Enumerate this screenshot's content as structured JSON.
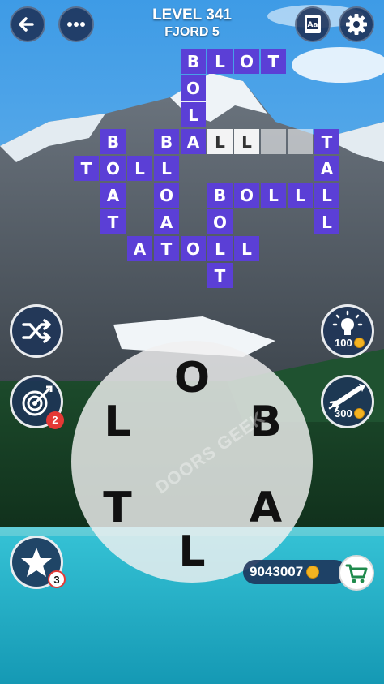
{
  "header": {
    "level_title": "LEVEL 341",
    "pack_name": "FJORD 5"
  },
  "grid": {
    "solved_color": "#5b3fd6",
    "cells": [
      {
        "id": "r0c4",
        "letter": "B",
        "state": "solved"
      },
      {
        "id": "r0c5",
        "letter": "L",
        "state": "solved"
      },
      {
        "id": "r0c6",
        "letter": "O",
        "state": "solved"
      },
      {
        "id": "r0c7",
        "letter": "T",
        "state": "solved"
      },
      {
        "id": "r1c4",
        "letter": "O",
        "state": "solved"
      },
      {
        "id": "r2c4",
        "letter": "L",
        "state": "solved"
      },
      {
        "id": "r3c1",
        "letter": "B",
        "state": "solved"
      },
      {
        "id": "r3c3",
        "letter": "B",
        "state": "solved"
      },
      {
        "id": "r3c4",
        "letter": "A",
        "state": "solved"
      },
      {
        "id": "r3c5",
        "letter": "L",
        "state": "hint"
      },
      {
        "id": "r3c6",
        "letter": "L",
        "state": "hint"
      },
      {
        "id": "r3c7",
        "letter": "",
        "state": "empty"
      },
      {
        "id": "r3c8",
        "letter": "",
        "state": "empty"
      },
      {
        "id": "r3c9",
        "letter": "T",
        "state": "solved"
      },
      {
        "id": "r4c0",
        "letter": "T",
        "state": "solved"
      },
      {
        "id": "r4c1",
        "letter": "O",
        "state": "solved"
      },
      {
        "id": "r4c2",
        "letter": "L",
        "state": "solved"
      },
      {
        "id": "r4c3",
        "letter": "L",
        "state": "solved"
      },
      {
        "id": "r4c9",
        "letter": "A",
        "state": "solved"
      },
      {
        "id": "r5c1",
        "letter": "A",
        "state": "solved"
      },
      {
        "id": "r5c3",
        "letter": "O",
        "state": "solved"
      },
      {
        "id": "r5c5",
        "letter": "B",
        "state": "solved"
      },
      {
        "id": "r5c6",
        "letter": "O",
        "state": "solved"
      },
      {
        "id": "r5c7",
        "letter": "L",
        "state": "solved"
      },
      {
        "id": "r5c8",
        "letter": "L",
        "state": "solved"
      },
      {
        "id": "r5c9",
        "letter": "L",
        "state": "solved"
      },
      {
        "id": "r6c1",
        "letter": "T",
        "state": "solved"
      },
      {
        "id": "r6c3",
        "letter": "A",
        "state": "solved"
      },
      {
        "id": "r6c5",
        "letter": "O",
        "state": "solved"
      },
      {
        "id": "r6c9",
        "letter": "L",
        "state": "solved"
      },
      {
        "id": "r7c2",
        "letter": "A",
        "state": "solved"
      },
      {
        "id": "r7c3",
        "letter": "T",
        "state": "solved"
      },
      {
        "id": "r7c4",
        "letter": "O",
        "state": "solved"
      },
      {
        "id": "r7c5",
        "letter": "L",
        "state": "solved"
      },
      {
        "id": "r7c6",
        "letter": "L",
        "state": "solved"
      },
      {
        "id": "r8c5",
        "letter": "T",
        "state": "solved"
      }
    ]
  },
  "wheel": {
    "letters": [
      "O",
      "B",
      "A",
      "L",
      "T",
      "L"
    ]
  },
  "boosters": {
    "hint_cost": "100",
    "rocket_cost": "300",
    "target_badge": "2",
    "star_badge": "3"
  },
  "coins": {
    "balance": "9043007"
  },
  "watermark": "DOORS GEEK",
  "colors": {
    "button_bg": "#1c3158",
    "badge_red": "#e53935",
    "coin_gold": "#f4b321",
    "cart_green": "#1f8a4c"
  }
}
